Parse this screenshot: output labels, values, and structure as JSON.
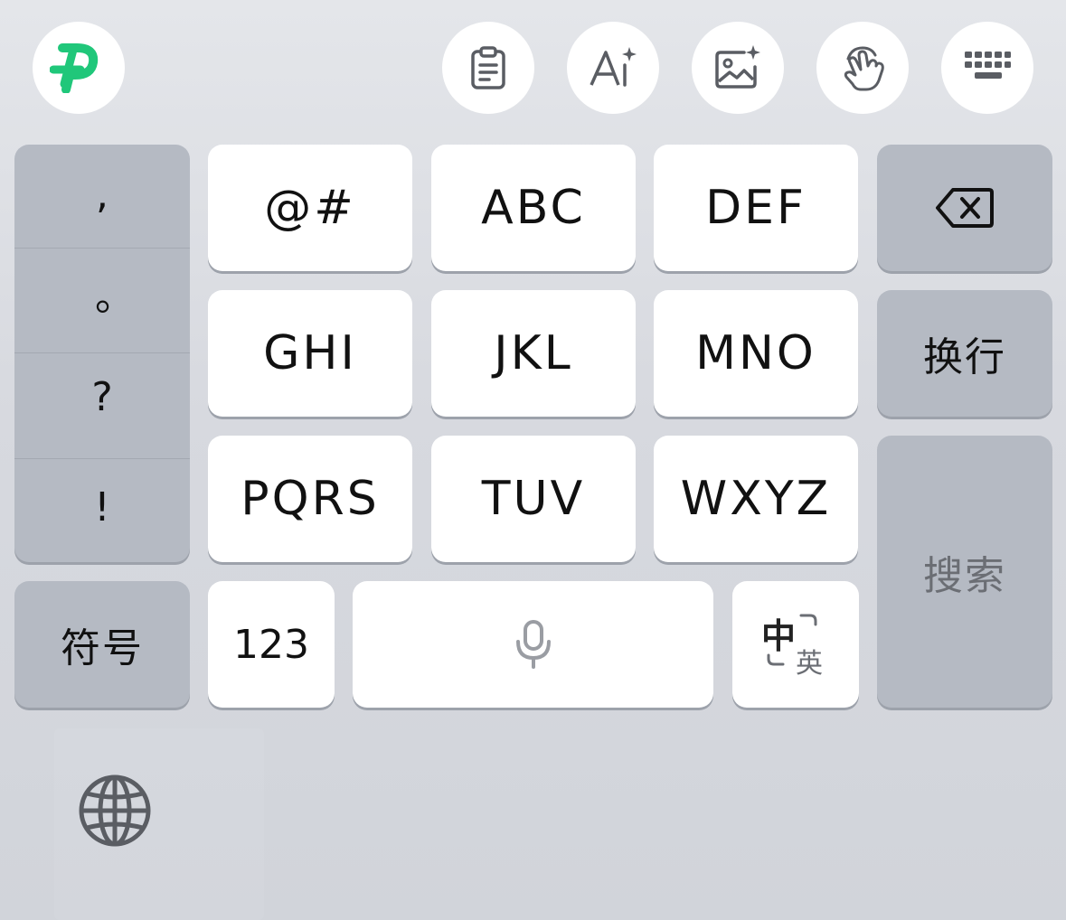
{
  "toolbar": {
    "logo_icon": "brand-p-logo-icon",
    "logo_color": "#20c77a",
    "buttons": [
      {
        "name": "clipboard",
        "icon": "clipboard-icon"
      },
      {
        "name": "ai-write",
        "icon": "ai-sparkle-icon"
      },
      {
        "name": "ai-image",
        "icon": "image-sparkle-icon"
      },
      {
        "name": "gesture",
        "icon": "hand-tap-icon"
      },
      {
        "name": "hide-keyboard",
        "icon": "keyboard-icon"
      }
    ]
  },
  "keyboard": {
    "punctuation": [
      ",",
      "。",
      "?",
      "!"
    ],
    "symbols_label": "符号",
    "keys": {
      "k1": "@#",
      "k2": "ABC",
      "k3": "DEF",
      "k4": "GHI",
      "k5": "JKL",
      "k6": "MNO",
      "k7": "PQRS",
      "k8": "TUV",
      "k9": "WXYZ"
    },
    "numbers_label": "123",
    "space_icon": "microphone-icon",
    "lang_switch": {
      "primary": "中",
      "secondary": "英"
    },
    "backspace_icon": "backspace-icon",
    "newline_label": "换行",
    "search_label": "搜索",
    "globe_icon": "globe-icon"
  },
  "colors": {
    "key_light": "#ffffff",
    "key_dark": "#b5bac3",
    "background": "#d7d9df",
    "accent_green": "#20c77a"
  }
}
